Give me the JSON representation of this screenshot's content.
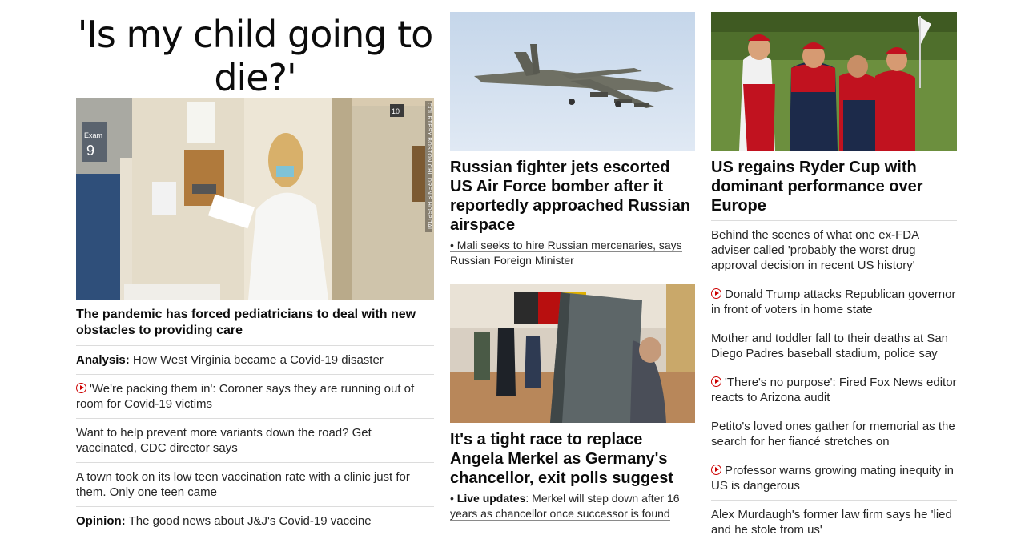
{
  "left": {
    "headline": "'Is my child going to die?'",
    "photo_credit": "COURTESY BOSTON CHILDREN'S HOSPITAL",
    "photo_labels": {
      "exam": "Exam",
      "room": "9",
      "door": "10"
    },
    "lead": "The pandemic has forced pediatricians to deal with new obstacles to providing care",
    "items": [
      {
        "prefix": "Analysis:",
        "text": "How West Virginia became a Covid-19 disaster",
        "video": false
      },
      {
        "prefix": "",
        "text": "'We're packing them in': Coroner says they are running out of room for Covid-19 victims",
        "video": true
      },
      {
        "prefix": "",
        "text": "Want to help prevent more variants down the road? Get vaccinated, CDC director says",
        "video": false
      },
      {
        "prefix": "",
        "text": "A town took on its low teen vaccination rate with a clinic just for them. Only one teen came",
        "video": false
      },
      {
        "prefix": "Opinion:",
        "text": "The good news about J&J's Covid-19 vaccine",
        "video": false
      }
    ]
  },
  "middle": {
    "story1": {
      "title": "Russian fighter jets escorted US Air Force bomber after it reportedly approached Russian airspace",
      "bullet": "• Mali seeks to hire Russian mercenaries, says Russian Foreign Minister"
    },
    "story2": {
      "title": "It's a tight race to replace Angela Merkel as Germany's chancellor, exit polls suggest",
      "bullet_prefix": "• ",
      "bullet_bold": "Live updates",
      "bullet_text": ": Merkel will step down after 16 years as chancellor once successor is found"
    }
  },
  "right": {
    "title": "US regains Ryder Cup with dominant performance over Europe",
    "items": [
      {
        "text": "Behind the scenes of what one ex-FDA adviser called 'probably the worst drug approval decision in recent US history'",
        "video": false
      },
      {
        "text": "Donald Trump attacks Republican governor in front of voters in home state",
        "video": true
      },
      {
        "text": "Mother and toddler fall to their deaths at San Diego Padres baseball stadium, police say",
        "video": false
      },
      {
        "text": "'There's no purpose': Fired Fox News editor reacts to Arizona audit",
        "video": true
      },
      {
        "text": "Petito's loved ones gather for memorial as the search for her fiancé stretches on",
        "video": false
      },
      {
        "text": "Professor warns growing mating inequity in US is dangerous",
        "video": true
      },
      {
        "text": "Alex Murdaugh's former law firm says he 'lied and he stole from us'",
        "video": false
      }
    ]
  },
  "colors": {
    "accent": "#cc0000",
    "divider": "#dcdcdc",
    "text": "#0c0c0c"
  }
}
